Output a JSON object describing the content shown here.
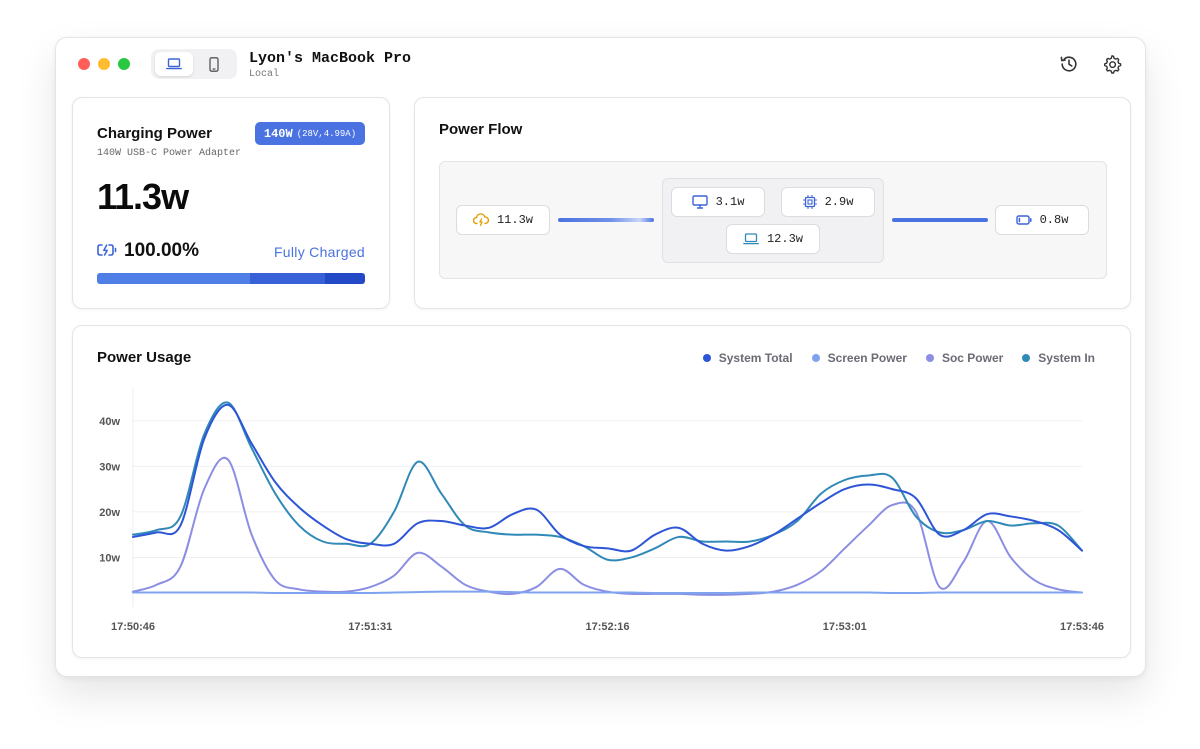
{
  "header": {
    "title": "Lyon's MacBook Pro",
    "subtitle": "Local"
  },
  "charging": {
    "title": "Charging Power",
    "adapter": "140W USB-C Power Adapter",
    "badge_main": "140W",
    "badge_sub": "(28V,4.99A)",
    "power": "11.3w",
    "percent": "100.00%",
    "status": "Fully Charged",
    "progress": 1.0
  },
  "flow": {
    "title": "Power Flow",
    "input": "11.3w",
    "screen": "3.1w",
    "soc": "2.9w",
    "system": "12.3w",
    "battery": "0.8w"
  },
  "usage": {
    "title": "Power Usage"
  },
  "chart_data": {
    "type": "line",
    "title": "Power Usage",
    "x": [
      "17:50:46",
      "17:50:51",
      "17:50:56",
      "17:51:01",
      "17:51:06",
      "17:51:11",
      "17:51:16",
      "17:51:21",
      "17:51:26",
      "17:51:31",
      "17:51:36",
      "17:51:41",
      "17:51:46",
      "17:51:51",
      "17:51:56",
      "17:52:01",
      "17:52:06",
      "17:52:11",
      "17:52:16",
      "17:52:21",
      "17:52:26",
      "17:52:31",
      "17:52:36",
      "17:52:41",
      "17:52:46",
      "17:52:51",
      "17:52:56",
      "17:53:01",
      "17:53:06",
      "17:53:11",
      "17:53:16",
      "17:53:21",
      "17:53:26",
      "17:53:31",
      "17:53:36",
      "17:53:41",
      "17:53:46"
    ],
    "x_ticks": [
      "17:50:46",
      "17:51:31",
      "17:52:16",
      "17:53:01",
      "17:53:46"
    ],
    "y_ticks": [
      "10w",
      "20w",
      "30w",
      "40w"
    ],
    "ylim": [
      0,
      45
    ],
    "grid": true,
    "legend_position": "top-right",
    "series": [
      {
        "name": "System Total",
        "color": "#2d55d6",
        "values": [
          14.5,
          15.5,
          17,
          36,
          43.5,
          35,
          26.5,
          21,
          17,
          14,
          13,
          13,
          17.5,
          18,
          17,
          16.5,
          19.5,
          20.5,
          15,
          12.5,
          12,
          11.5,
          15,
          16.5,
          13,
          11.5,
          12.5,
          15,
          18.5,
          22,
          25,
          26,
          25,
          23,
          15,
          16,
          19.5,
          19,
          18,
          16,
          11.5
        ]
      },
      {
        "name": "Screen Power",
        "color": "#7fa3ee",
        "values": [
          2.3,
          2.3,
          2.3,
          2.3,
          2.3,
          2.3,
          2.2,
          2.2,
          2.2,
          2.2,
          2.2,
          2.3,
          2.4,
          2.5,
          2.5,
          2.5,
          2.4,
          2.3,
          2.3,
          2.3,
          2.3,
          2.3,
          2.2,
          2.2,
          2.2,
          2.2,
          2.3,
          2.3,
          2.3,
          2.3,
          2.3,
          2.3,
          2.2,
          2.2,
          2.3,
          2.3,
          2.3,
          2.3,
          2.3,
          2.3,
          2.3
        ]
      },
      {
        "name": "Soc Power",
        "color": "#8b8fe3",
        "values": [
          2.5,
          4,
          8,
          25,
          31.5,
          15,
          5,
          3,
          2.5,
          2.5,
          3.5,
          6,
          11,
          8,
          4,
          2.5,
          2,
          3.5,
          7.5,
          4,
          2.5,
          2,
          2,
          2,
          1.8,
          1.8,
          2,
          2.5,
          4,
          7,
          12,
          17,
          21.5,
          20,
          3.5,
          9,
          18,
          10,
          5,
          3,
          2.3
        ]
      },
      {
        "name": "System In",
        "color": "#3189b8",
        "values": [
          15,
          16,
          19,
          37,
          44,
          34,
          24,
          17,
          13.5,
          13,
          13,
          20,
          31,
          24,
          17,
          15.5,
          15,
          15,
          14.5,
          12.5,
          9.5,
          10,
          12,
          14.5,
          13.5,
          13.5,
          13.5,
          15,
          18,
          24,
          27,
          28,
          27.5,
          19,
          15.5,
          16,
          18,
          17,
          17.5,
          17,
          11.5
        ]
      }
    ]
  }
}
